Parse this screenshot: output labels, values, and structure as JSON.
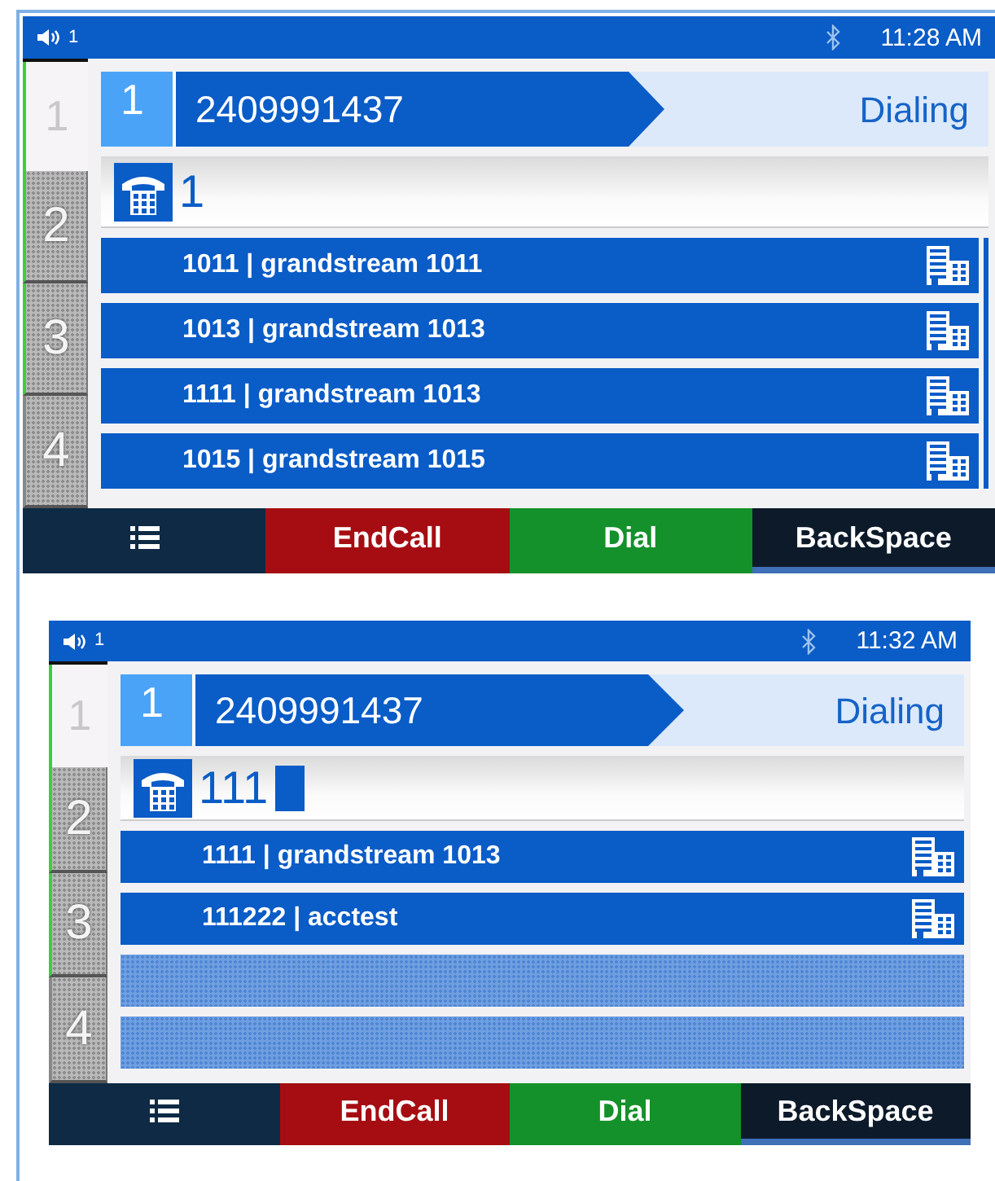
{
  "screens": [
    {
      "status": {
        "line_label": "1",
        "time": "11:28 AM"
      },
      "lines": [
        {
          "label": "1",
          "selected": true,
          "registered": true
        },
        {
          "label": "2",
          "selected": false,
          "registered": true
        },
        {
          "label": "3",
          "selected": false,
          "registered": true
        },
        {
          "label": "4",
          "selected": false,
          "registered": false
        }
      ],
      "call": {
        "line": "1",
        "number": "2409991437",
        "state": "Dialing"
      },
      "dial_input": {
        "value": "1",
        "cursor": false
      },
      "results": [
        {
          "kind": "contact",
          "text": "1011 | grandstream 1011"
        },
        {
          "kind": "contact",
          "text": "1013 | grandstream 1013"
        },
        {
          "kind": "contact",
          "text": "1111 | grandstream 1013"
        },
        {
          "kind": "contact",
          "text": "1015 | grandstream 1015"
        }
      ],
      "softkeys": [
        {
          "kind": "menu",
          "selected": false
        },
        {
          "kind": "end",
          "label": "EndCall",
          "selected": false
        },
        {
          "kind": "dial",
          "label": "Dial",
          "selected": false
        },
        {
          "kind": "plain",
          "label": "BackSpace",
          "selected": true
        }
      ]
    },
    {
      "status": {
        "line_label": "1",
        "time": "11:32 AM"
      },
      "lines": [
        {
          "label": "1",
          "selected": true,
          "registered": true
        },
        {
          "label": "2",
          "selected": false,
          "registered": true
        },
        {
          "label": "3",
          "selected": false,
          "registered": true
        },
        {
          "label": "4",
          "selected": false,
          "registered": false
        }
      ],
      "call": {
        "line": "1",
        "number": "2409991437",
        "state": "Dialing"
      },
      "dial_input": {
        "value": "111",
        "cursor": true
      },
      "results": [
        {
          "kind": "contact",
          "text": "1111 | grandstream 1013"
        },
        {
          "kind": "contact",
          "text": "111222 | acctest"
        },
        {
          "kind": "empty"
        },
        {
          "kind": "empty"
        }
      ],
      "softkeys": [
        {
          "kind": "menu",
          "selected": false
        },
        {
          "kind": "end",
          "label": "EndCall",
          "selected": false
        },
        {
          "kind": "dial",
          "label": "Dial",
          "selected": false
        },
        {
          "kind": "plain",
          "label": "BackSpace",
          "selected": true
        }
      ]
    }
  ]
}
